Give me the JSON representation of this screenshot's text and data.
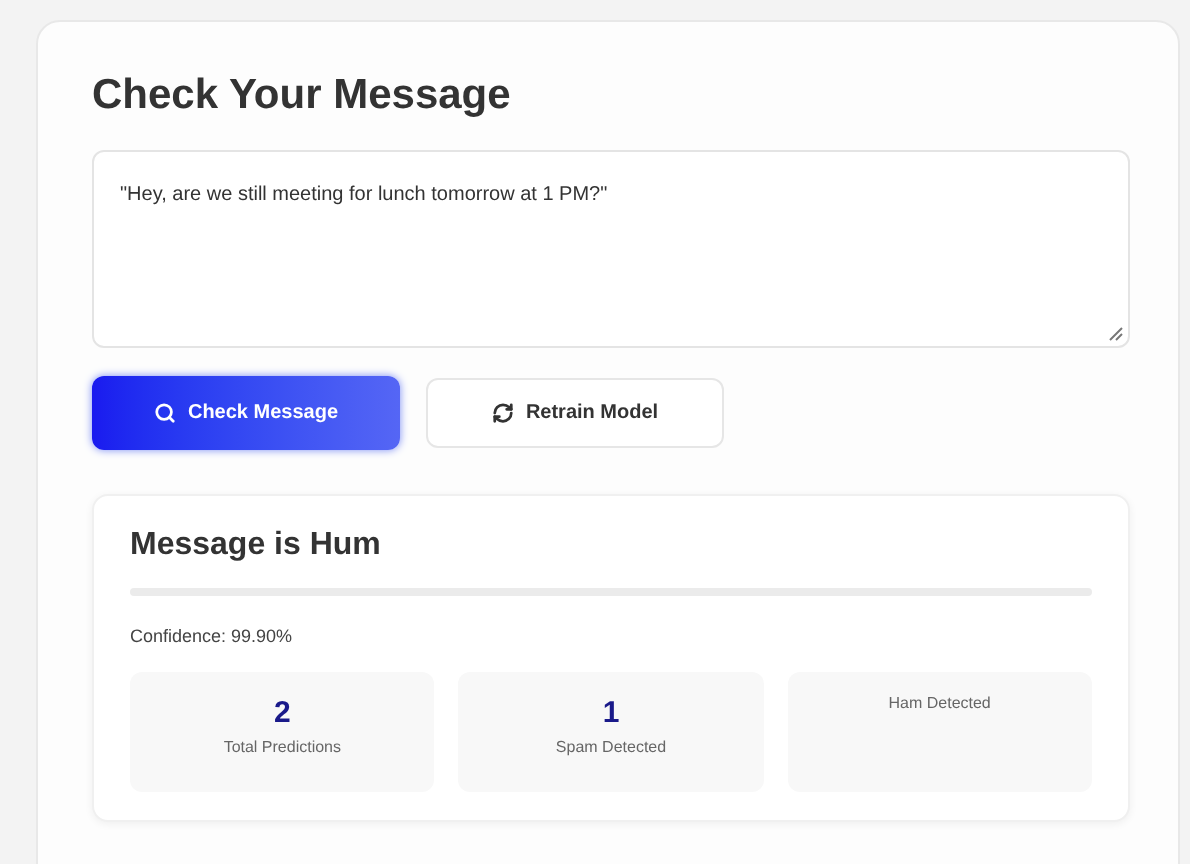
{
  "title": "Check Your Message",
  "message": {
    "value": "\"Hey, are we still meeting for lunch tomorrow at 1 PM?\""
  },
  "buttons": [
    {
      "label": "Check Message",
      "kind": "primary"
    },
    {
      "label": "Retrain Model",
      "kind": "secondary"
    }
  ],
  "result": {
    "title": "Message is Hum",
    "confidence": "Confidence: 99.90%",
    "stats": [
      {
        "value": "2",
        "label": "Total Predictions"
      },
      {
        "value": "1",
        "label": "Spam Detected"
      },
      {
        "label": "Ham Detected"
      }
    ]
  }
}
